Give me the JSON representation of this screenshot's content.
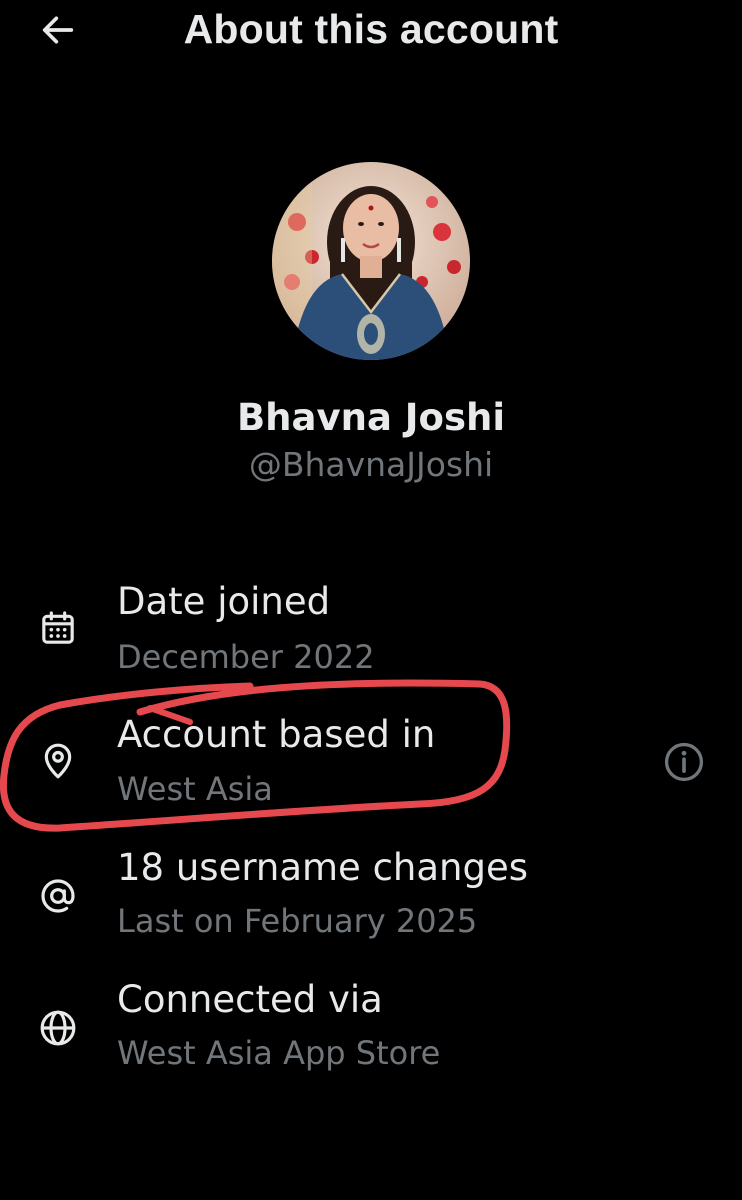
{
  "header": {
    "title": "About this account",
    "back_icon": "arrow-left-icon"
  },
  "profile": {
    "display_name": "Bhavna Joshi",
    "handle": "@BhavnaJJoshi"
  },
  "details": [
    {
      "icon": "calendar-icon",
      "title": "Date joined",
      "subtitle": "December 2022"
    },
    {
      "icon": "location-pin-icon",
      "title": "Account based in",
      "subtitle": "West Asia",
      "info_icon": "info-icon"
    },
    {
      "icon": "at-sign-icon",
      "title": "18 username changes",
      "subtitle": "Last on February 2025"
    },
    {
      "icon": "globe-icon",
      "title": "Connected via",
      "subtitle": "West Asia App Store"
    }
  ],
  "colors": {
    "background": "#000000",
    "primary_text": "#e7e9ea",
    "secondary_text": "#71767b",
    "annotation": "#e5484d"
  }
}
